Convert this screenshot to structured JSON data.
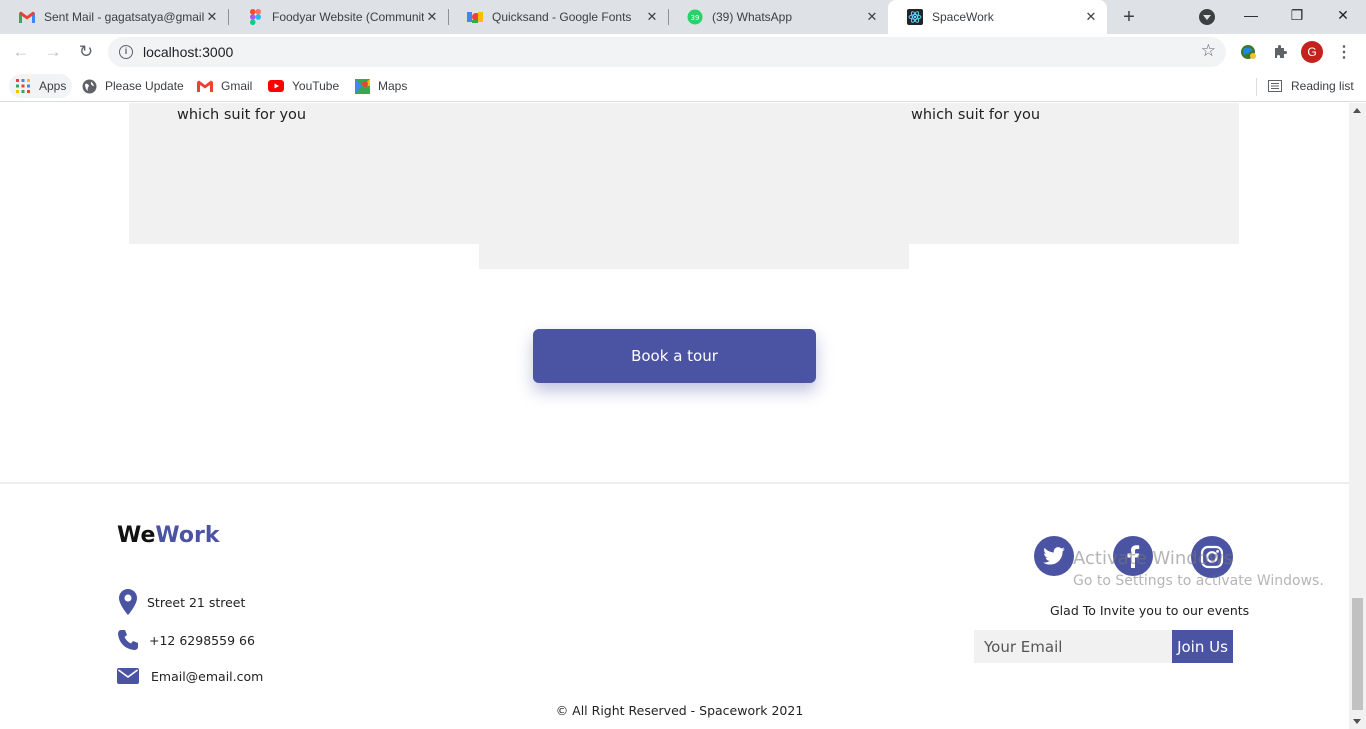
{
  "browser": {
    "tabs": [
      {
        "title": "Sent Mail - gagatsatya@gmail.com",
        "icon": "gmail-icon"
      },
      {
        "title": "Foodyar Website (Community)",
        "icon": "figma-icon"
      },
      {
        "title": "Quicksand - Google Fonts",
        "icon": "google-fonts-icon"
      },
      {
        "title": "(39) WhatsApp",
        "icon": "whatsapp-icon",
        "badge": "39"
      },
      {
        "title": "SpaceWork",
        "icon": "react-icon",
        "active": true
      }
    ],
    "url": "localhost:3000",
    "profile_initial": "G",
    "bookmarks": [
      {
        "label": "Apps"
      },
      {
        "label": "Please Update"
      },
      {
        "label": "Gmail"
      },
      {
        "label": "YouTube"
      },
      {
        "label": "Maps"
      }
    ],
    "reading_list": "Reading list"
  },
  "page": {
    "cards": {
      "left_text": "which suit for you",
      "right_text": "which suit for you"
    },
    "tour_button": "Book a tour",
    "footer": {
      "logo_we": "We",
      "logo_work": "Work",
      "address": "Street 21 street",
      "phone": "+12 6298559 66",
      "email": "Email@email.com",
      "invite_text": "Glad To Invite you to our events",
      "email_placeholder": "Your Email",
      "join_button": "Join Us",
      "copyright": "© All Right Reserved - Spacework 2021"
    }
  },
  "os_watermark": {
    "line1": "Activate Windows",
    "line2": "Go to Settings to activate Windows."
  },
  "colors": {
    "accent": "#4b53a3",
    "card_bg": "#f1f1f1"
  }
}
